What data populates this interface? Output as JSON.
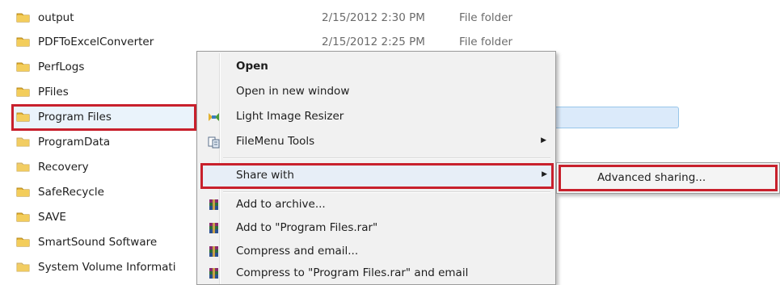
{
  "files": [
    {
      "name": "output",
      "date": "2/15/2012 2:30 PM",
      "type": "File folder"
    },
    {
      "name": "PDFToExcelConverter",
      "date": "2/15/2012 2:25 PM",
      "type": "File folder"
    },
    {
      "name": "PerfLogs",
      "date": "",
      "type": ""
    },
    {
      "name": "PFiles",
      "date": "",
      "type": ""
    },
    {
      "name": "Program Files",
      "date": "",
      "type": ""
    },
    {
      "name": "ProgramData",
      "date": "",
      "type": ""
    },
    {
      "name": "Recovery",
      "date": "",
      "type": ""
    },
    {
      "name": "SafeRecycle",
      "date": "",
      "type": ""
    },
    {
      "name": "SAVE",
      "date": "",
      "type": ""
    },
    {
      "name": "SmartSound Software",
      "date": "",
      "type": ""
    },
    {
      "name": "System Volume Informati",
      "date": "",
      "type": ""
    }
  ],
  "context_menu": {
    "open": "Open",
    "open_new_window": "Open in new window",
    "light_image_resizer": "Light Image Resizer",
    "filemenu_tools": "FileMenu Tools",
    "share_with": "Share with",
    "add_to_archive": "Add to archive...",
    "add_to_rar": "Add to \"Program Files.rar\"",
    "compress_email": "Compress and email...",
    "compress_rar_email": "Compress to \"Program Files.rar\" and email",
    "submenu_arrow": "▶"
  },
  "share_submenu": {
    "advanced_sharing": "Advanced sharing..."
  },
  "colors": {
    "highlight_border": "#c8202c",
    "folder_yellow": "#e8b637",
    "selection_blue": "#dbeafa"
  },
  "icons": {
    "folder": "folder-icon",
    "resizer": "image-resizer-icon",
    "filemenu": "filemenu-tools-icon",
    "winrar": "winrar-archive-icon"
  }
}
